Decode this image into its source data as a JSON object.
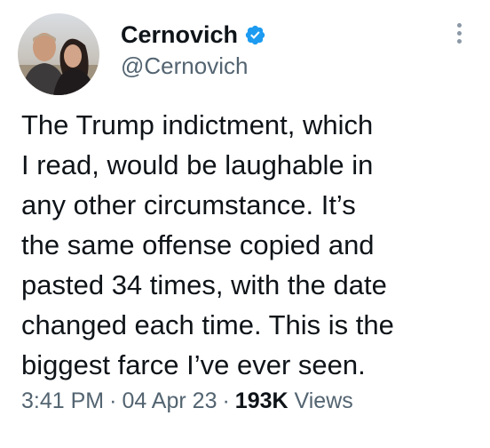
{
  "author": {
    "display_name": "Cernovich",
    "handle": "@Cernovich",
    "verified_badge_icon": "verified-badge-icon",
    "verified_color": "#1d9bf0"
  },
  "tweet": {
    "text": "The Trump indictment, which\nI read, would be laughable in\nany other circumstance. It’s\nthe same offense copied and\npasted 34 times, with the date\nchanged each time. This is the\nbiggest farce I’ve ever seen.",
    "time": "3:41 PM",
    "separator": "·",
    "date": "04 Apr 23",
    "views_count": "193K",
    "views_label": "Views"
  },
  "icons": {
    "more": "more-options-icon",
    "avatar": "avatar-photo"
  }
}
